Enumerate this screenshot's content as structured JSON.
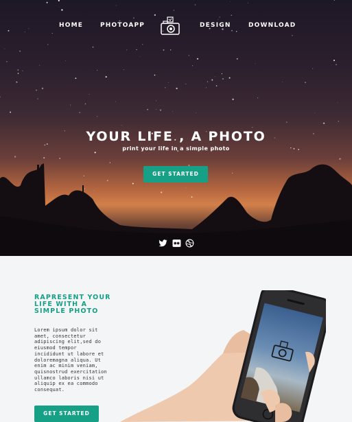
{
  "nav": {
    "items": [
      "HOME",
      "PHOTOAPP",
      "DESIGN",
      "DOWNLOAD"
    ]
  },
  "hero": {
    "title": "YOUR LIFE , A PHOTO",
    "subtitle": "print your life in a simple photo",
    "cta_label": "GET STARTED"
  },
  "social": {
    "icons": [
      "twitter-icon",
      "flickr-icon",
      "dribbble-icon"
    ]
  },
  "feature": {
    "title_lines": [
      "RAPRESENT YOUR",
      "LIFE WITH A",
      "SIMPLE PHOTO"
    ],
    "body_lines": [
      "Lorem ipsum dolor sit",
      "amet, consectetur",
      "adipiscing elit,sed do",
      "eiusmod tempor",
      "incididunt ut labore et",
      "doloremagna aliqua. Ut",
      "enim ac minim veniam,",
      "quisnostrud exercitation",
      "ullamco laboris nisi ut",
      "aliquip ex ea commodo",
      "consequat."
    ],
    "cta_label": "GET STARTED"
  },
  "colors": {
    "accent": "#16a085",
    "section_bg": "#f3f5f7"
  }
}
